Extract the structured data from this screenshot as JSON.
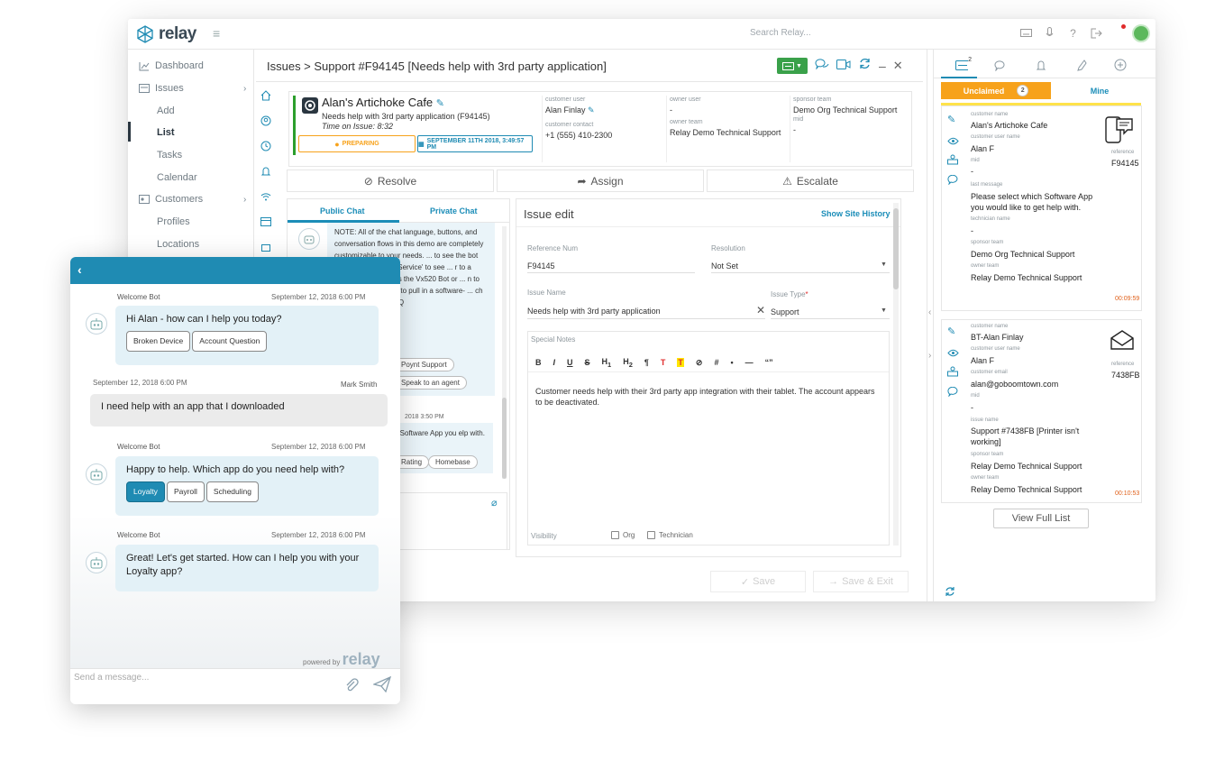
{
  "app": {
    "brand": "relay",
    "search_placeholder": "Search Relay..."
  },
  "sidebar": {
    "items": [
      {
        "label": "Dashboard"
      },
      {
        "label": "Issues"
      },
      {
        "label": "Add"
      },
      {
        "label": "List"
      },
      {
        "label": "Tasks"
      },
      {
        "label": "Calendar"
      },
      {
        "label": "Customers"
      },
      {
        "label": "Profiles"
      },
      {
        "label": "Locations"
      }
    ]
  },
  "header": {
    "breadcrumb": "Issues > Support #F94145 [Needs help with 3rd party application]"
  },
  "issue": {
    "customer_name": "Alan's Artichoke Cafe",
    "description": "Needs help with 3rd party application (F94145)",
    "time_on_issue": "Time on Issue: 8:32",
    "status": "PREPARING",
    "date": "SEPTEMBER 11TH 2018, 3:49:57 PM",
    "customer_user_label": "customer user",
    "customer_user": "Alan Finlay",
    "customer_contact_label": "customer contact",
    "customer_contact": "+1 (555) 410-2300",
    "owner_user_label": "owner user",
    "owner_user": "-",
    "owner_team_label": "owner team",
    "owner_team": "Relay Demo Technical Support",
    "sponsor_team_label": "sponsor team",
    "sponsor_team": "Demo Org Technical Support",
    "mid_label": "mid",
    "mid": "-"
  },
  "actions": {
    "resolve": "Resolve",
    "assign": "Assign",
    "escalate": "Escalate"
  },
  "chat": {
    "tab_public": "Public Chat",
    "tab_private": "Private Chat",
    "note_text": "NOTE: All of the chat language, buttons, and conversation flows in this demo are completely customizable to your needs. ... to see the bot answer a ... stomer Service' to see ... r to a human, click ... ch as the Vx520 Bot or ... n to pull in a device- ... n to pull in a software- ... ch as the WOMPLY FAQ",
    "pill1": "Poynt Support",
    "pill2": "Speak to an agent",
    "ts2": "2018 3:50 PM",
    "msg2": "n Software App you elp with.",
    "pill3": "Rating",
    "pill4": "Homebase"
  },
  "edit": {
    "title": "Issue edit",
    "history_link": "Show Site History",
    "ref_label": "Reference Num",
    "ref_value": "F94145",
    "resolution_label": "Resolution",
    "resolution_value": "Not Set",
    "issue_name_label": "Issue Name",
    "issue_name_value": "Needs help with 3rd party application",
    "issue_type_label": "Issue Type",
    "issue_type_value": "Support",
    "notes_label": "Special Notes",
    "notes_text": "Customer needs help with their 3rd party app integration with their tablet. The account appears to be deactivated.",
    "visibility_label": "Visibility",
    "vis_org": "Org",
    "vis_tech": "Technician",
    "save": "Save",
    "save_exit": "Save & Exit"
  },
  "right": {
    "unclaimed": "Unclaimed",
    "unclaimed_count": "2",
    "mine": "Mine",
    "tab_badge": "2",
    "card1": {
      "customer_name_label": "customer name",
      "customer_name": "Alan's Artichoke Cafe",
      "customer_user_label": "customer user name",
      "customer_user": "Alan F",
      "mid_label": "mid",
      "mid": "-",
      "last_message_label": "last message",
      "last_message": "Please select which Software App you would like to get help with.",
      "technician_label": "technician name",
      "technician": "-",
      "sponsor_label": "sponsor team",
      "sponsor": "Demo Org Technical Support",
      "owner_label": "owner team",
      "owner": "Relay Demo Technical Support",
      "reference_label": "reference",
      "reference": "F94145",
      "timer": "00:09:59"
    },
    "card2": {
      "customer_name_label": "customer name",
      "customer_name": "BT-Alan Finlay",
      "customer_user_label": "customer user name",
      "customer_user": "Alan F",
      "email_label": "customer email",
      "email": "alan@goboomtown.com",
      "mid_label": "mid",
      "mid": "-",
      "issue_label": "issue name",
      "issue": "Support #7438FB [Printer isn't working]",
      "sponsor_label": "sponsor team",
      "sponsor": "Relay Demo Technical Support",
      "owner_label": "owner team",
      "owner": "Relay Demo Technical Support",
      "reference_label": "reference",
      "reference": "7438FB",
      "timer": "00:10:53"
    },
    "view_full": "View Full List"
  },
  "widget": {
    "m1": {
      "sender": "Welcome Bot",
      "date": "September 12, 2018 6:00 PM",
      "text": "Hi Alan - how can I help you today?",
      "btn1": "Broken Device",
      "btn2": "Account Question"
    },
    "m2": {
      "sender": "Mark Smith",
      "date": "September 12, 2018 6:00 PM",
      "text": "I need help with an app that I downloaded"
    },
    "m3": {
      "sender": "Welcome Bot",
      "date": "September 12, 2018 6:00 PM",
      "text": "Happy to help. Which app do you need help with?",
      "btn1": "Loyalty",
      "btn2": "Payroll",
      "btn3": "Scheduling"
    },
    "m4": {
      "sender": "Welcome Bot",
      "date": "September 12, 2018 6:00 PM",
      "text": "Great! Let's get started. How can I help you with your Loyalty app?"
    },
    "powered_by": "powered by",
    "powered_brand": "relay",
    "input_placeholder": "Send a message..."
  },
  "colors": {
    "accent": "#1f8bb3",
    "orange": "#f7a21b",
    "green": "#3aa14a",
    "timer": "#e0611b"
  }
}
